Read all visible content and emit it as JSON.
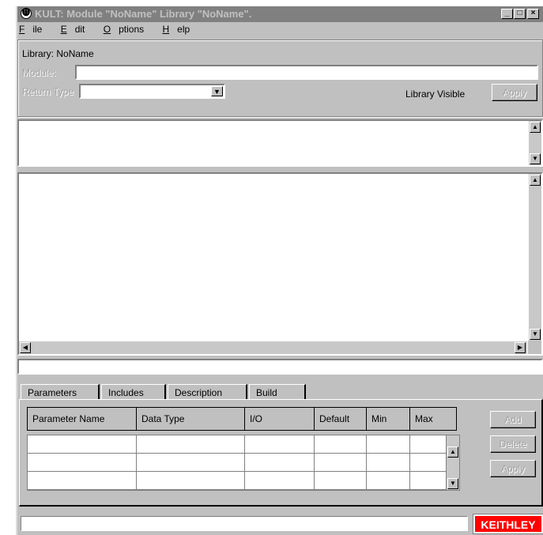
{
  "window": {
    "title": "KULT: Module \"NoName\" Library \"NoName\".",
    "app_icon": "kult-app-icon",
    "controls": [
      "_",
      "□",
      "×"
    ]
  },
  "menu": [
    {
      "label": "File",
      "key": "F",
      "rest": "ile"
    },
    {
      "label": "Edit",
      "key": "E",
      "rest": "dit"
    },
    {
      "label": "Options",
      "key": "O",
      "rest": "ptions"
    },
    {
      "label": "Help",
      "key": "H",
      "rest": "elp"
    }
  ],
  "library": {
    "label": "Library: NoName",
    "module_label": "Module:",
    "module_value": "",
    "return_type_label": "Return Type",
    "return_type_value": "",
    "visible_label": "Library Visible",
    "apply_label": "Apply"
  },
  "tabs": [
    "Parameters",
    "Includes",
    "Description",
    "Build"
  ],
  "active_tab": "Parameters",
  "parameters": {
    "columns": [
      "Parameter Name",
      "Data Type",
      "I/O",
      "Default",
      "Min",
      "Max"
    ],
    "rows": 3,
    "add_label": "Add",
    "delete_label": "Delete",
    "apply_label": "Apply"
  },
  "status": {
    "text": ""
  },
  "brand": {
    "logo_text": "KEITHLEY",
    "color": "#ff0000"
  },
  "colors": {
    "face": "#c0c0c0",
    "titlebar_inactive": "#808080"
  }
}
